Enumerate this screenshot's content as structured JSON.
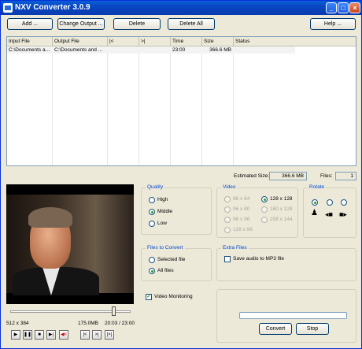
{
  "window": {
    "title": "NXV Converter 3.0.9",
    "minimize": "_",
    "maximize": "□",
    "close": "×"
  },
  "toolbar": {
    "add": "Add ...",
    "change_output": "Change Output ...",
    "delete": "Delete",
    "delete_all": "Delete All",
    "help": "Help ..."
  },
  "grid": {
    "headers": [
      "Input File",
      "Output File",
      "|<",
      ">|",
      "Time",
      "Size",
      "Status"
    ],
    "rows": [
      {
        "input": "C:\\Documents a...",
        "output": "C:\\Documents and ...",
        "start": "",
        "end": "",
        "time": "23:00",
        "size": "366.6 MB",
        "status": ""
      }
    ]
  },
  "summary": {
    "estimated_label": "Estimated Size:",
    "estimated_value": "366.6 MB",
    "files_label": "Files:",
    "files_value": "1"
  },
  "quality": {
    "title": "Quality",
    "options": [
      "High",
      "Middle",
      "Low"
    ],
    "selected": "Middle"
  },
  "video": {
    "title": "Video",
    "options": [
      "96 x 64",
      "128 x 128",
      "96 x 80",
      "160 x 128",
      "96 x 96",
      "208 x 144",
      "128 x 96"
    ],
    "selected": "128 x 128"
  },
  "rotate": {
    "title": "Rotate",
    "selected_index": 0
  },
  "files_to_convert": {
    "title": "Files to Convert",
    "options": [
      "Selected file",
      "All files"
    ],
    "selected": "All files"
  },
  "extra_files": {
    "title": "Extra Files",
    "save_audio_label": "Save audio to MP3 file",
    "save_audio_checked": false
  },
  "monitoring": {
    "label": "Video Monitoring",
    "checked": true
  },
  "player": {
    "resolution": "512 x 384",
    "size": "175.0MB",
    "time": "20:03 / 23:00",
    "position_fraction": 0.87
  },
  "convert": {
    "convert_label": "Convert",
    "stop_label": "Stop",
    "progress": 0
  }
}
